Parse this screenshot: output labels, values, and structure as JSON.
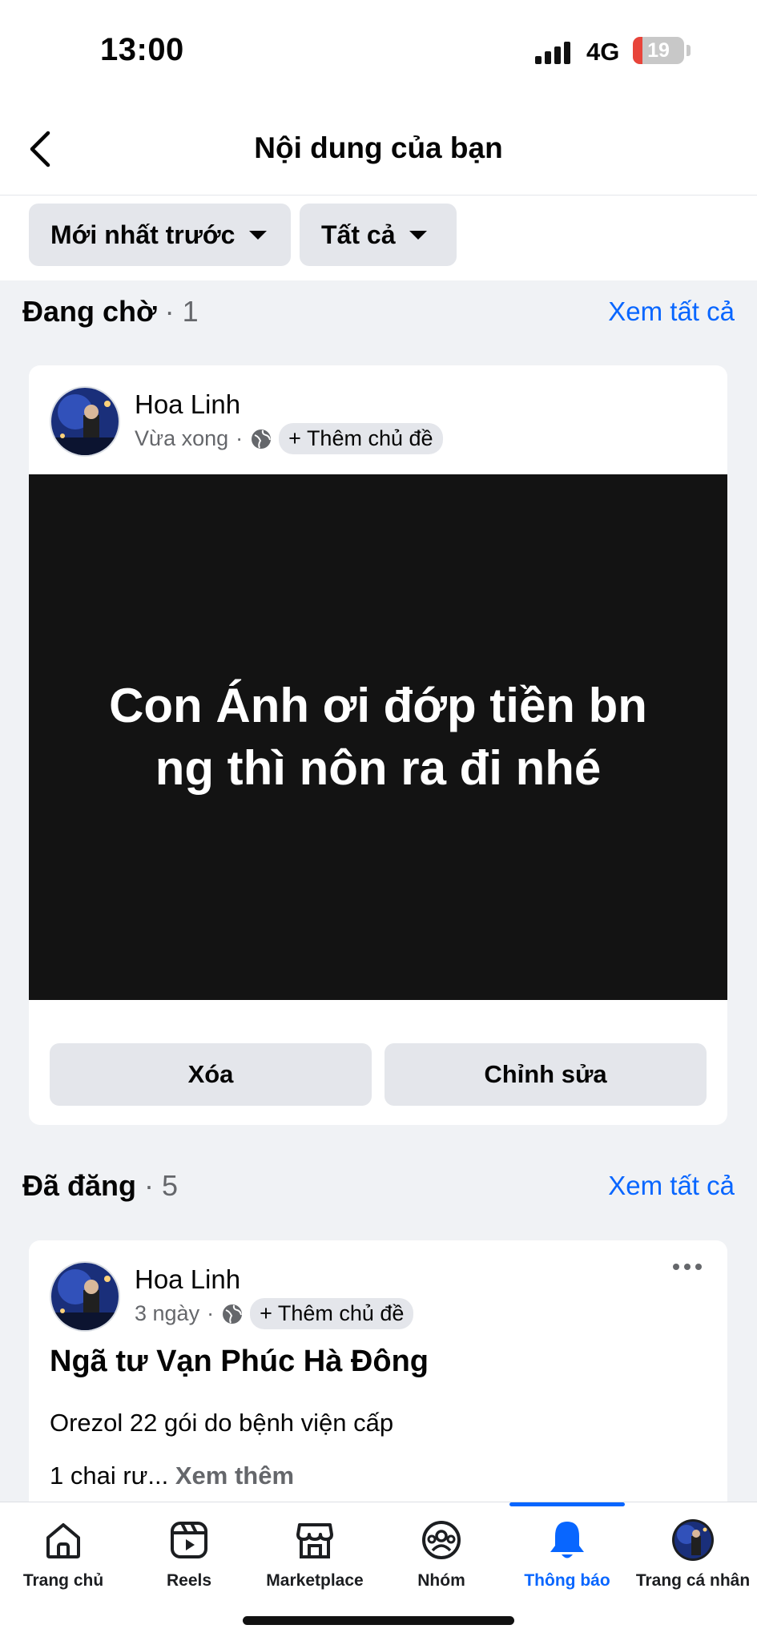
{
  "status_bar": {
    "time": "13:00",
    "network": "4G",
    "battery": "19",
    "battery_color": "#e8443a"
  },
  "header": {
    "title": "Nội dung của bạn"
  },
  "filters": [
    {
      "label": "Mới nhất trước"
    },
    {
      "label": "Tất cả"
    }
  ],
  "pending": {
    "title": "Đang chờ",
    "count": "· 1",
    "see_all": "Xem tất cả",
    "post": {
      "author": "Hoa Linh",
      "time": "Vừa xong",
      "add_topic": "+ Thêm chủ đề",
      "body_line1": "Con Ánh ơi đớp tiền bn",
      "body_line2": "ng thì nôn ra đi nhé",
      "delete_label": "Xóa",
      "edit_label": "Chỉnh sửa"
    }
  },
  "published": {
    "title": "Đã đăng",
    "count": "· 5",
    "see_all": "Xem tất cả",
    "post": {
      "author": "Hoa Linh",
      "time": "3 ngày",
      "add_topic": "+ Thêm chủ đề",
      "heading": "Ngã tư Vạn Phúc Hà Đông",
      "line1": "Orezol 22 gói do bệnh viện cấp",
      "line2": "1 chai rư...",
      "see_more": "Xem thêm"
    }
  },
  "nav": {
    "accent": "#0866ff",
    "items": [
      {
        "label": "Trang chủ",
        "icon": "home-icon"
      },
      {
        "label": "Reels",
        "icon": "reels-icon"
      },
      {
        "label": "Marketplace",
        "icon": "marketplace-icon"
      },
      {
        "label": "Nhóm",
        "icon": "groups-icon"
      },
      {
        "label": "Thông báo",
        "icon": "bell-icon",
        "active": true
      },
      {
        "label": "Trang cá nhân",
        "icon": "profile-avatar"
      }
    ]
  }
}
